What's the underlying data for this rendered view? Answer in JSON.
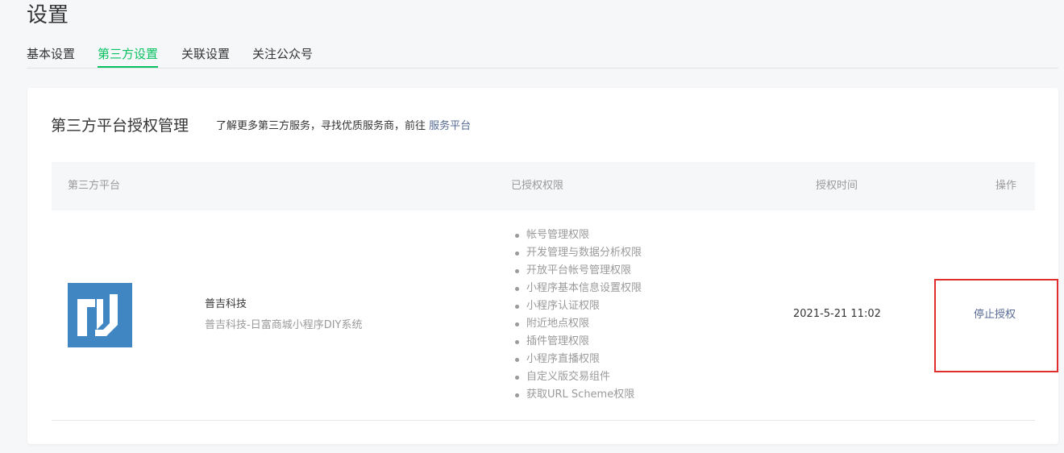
{
  "page": {
    "title": "设置"
  },
  "tabs": [
    {
      "label": "基本设置",
      "active": false
    },
    {
      "label": "第三方设置",
      "active": true
    },
    {
      "label": "关联设置",
      "active": false
    },
    {
      "label": "关注公众号",
      "active": false
    }
  ],
  "section": {
    "title": "第三方平台授权管理",
    "description": "了解更多第三方服务，寻找优质服务商，前往",
    "link_label": "服务平台"
  },
  "table": {
    "columns": [
      "第三方平台",
      "已授权权限",
      "授权时间",
      "操作"
    ],
    "rows": [
      {
        "logo_icon": "platform-logo-icon",
        "name": "普吉科技",
        "subtitle": "普吉科技-日富商城小程序DIY系统",
        "permissions": [
          "帐号管理权限",
          "开发管理与数据分析权限",
          "开放平台帐号管理权限",
          "小程序基本信息设置权限",
          "小程序认证权限",
          "附近地点权限",
          "插件管理权限",
          "小程序直播权限",
          "自定义版交易组件",
          "获取URL Scheme权限"
        ],
        "auth_time": "2021-5-21 11:02",
        "action_label": "停止授权"
      }
    ]
  },
  "colors": {
    "accent_green": "#07c160",
    "link_blue": "#576b95",
    "logo_blue": "#3f86c3",
    "highlight_red": "#e02e2e"
  }
}
